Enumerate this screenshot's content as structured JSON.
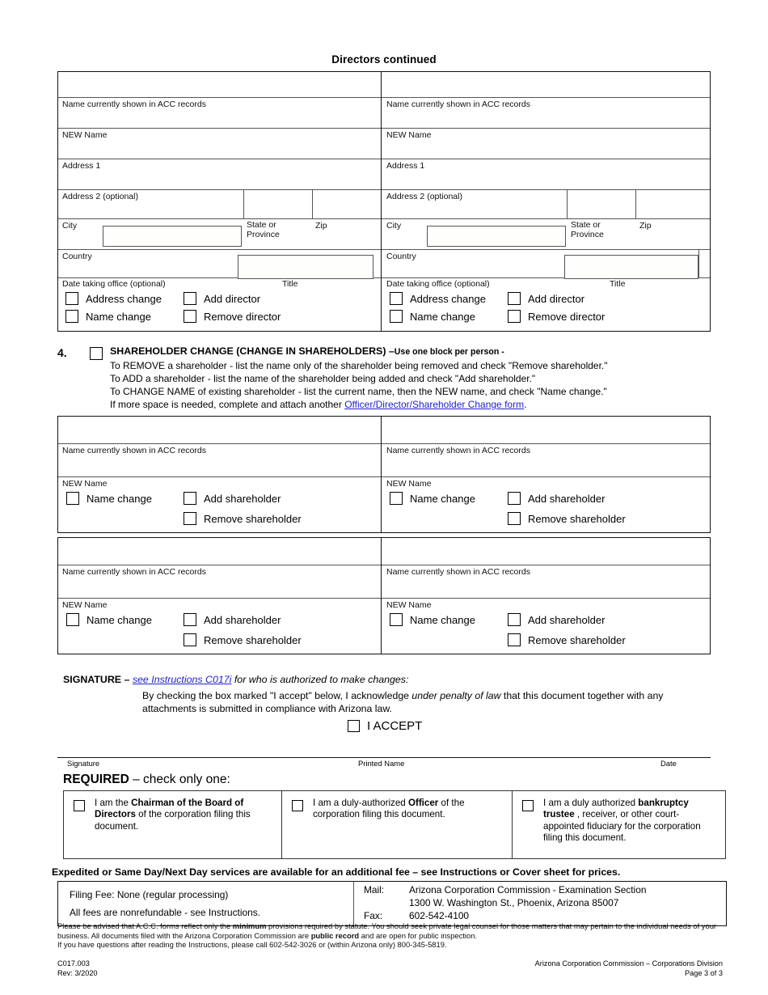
{
  "page": {
    "title": "Directors continued"
  },
  "directors_table": {
    "labels": {
      "name_current": "Name currently shown in ACC records",
      "new_name": "NEW Name",
      "address1": "Address 1",
      "address2": "Address 2 (optional)",
      "city": "City",
      "state_province": "State or Province",
      "zip": "Zip",
      "country": "Country",
      "date_taking_office": "Date taking office (optional)",
      "title": "Title"
    },
    "checkboxes": {
      "address_change": "Address change",
      "add_director": "Add director",
      "name_change": "Name change",
      "remove_director": "Remove director"
    }
  },
  "section4": {
    "number": "4.",
    "heading": "SHAREHOLDER CHANGE (CHANGE IN SHAREHOLDERS) –",
    "heading_sub": "Use one block per person -",
    "line1": "To REMOVE a shareholder - list the name only of the shareholder being removed and check \"Remove shareholder.\"",
    "line2": "To ADD  a shareholder - list the name of the shareholder being added and check \"Add shareholder.\"",
    "line3": "To CHANGE NAME of existing shareholder - list the current name, then the NEW name, and check \"Name change.\"",
    "line4_pre": "If more space is needed, complete and attach another ",
    "line4_link": "Officer/Director/Shareholder Change form",
    "line4_post": "."
  },
  "shareholder_table": {
    "labels": {
      "name_current": "Name currently shown in ACC records",
      "new_name": "NEW Name"
    },
    "checkboxes": {
      "name_change": "Name change",
      "add_shareholder": "Add shareholder",
      "remove_shareholder": "Remove shareholder"
    }
  },
  "signature": {
    "heading": "SIGNATURE – ",
    "link": "see Instructions C017i",
    "heading_rest": " for who is authorized to make changes:",
    "body_pre": "By checking the box marked \"I accept\" below, I acknowledge ",
    "body_em": "under penalty of law",
    "body_post": " that this document together with any attachments is submitted in compliance with Arizona law.",
    "accept_label": "I ACCEPT",
    "caption_signature": "Signature",
    "caption_printed_name": "Printed Name",
    "caption_date": "Date"
  },
  "required": {
    "title_bold": "REQUIRED",
    "title_rest": " – check only one:",
    "options": [
      {
        "pre": "I am the ",
        "bold": "Chairman of the Board of Directors",
        "post": " of the corporation filing this document."
      },
      {
        "pre": "I am a duly-authorized ",
        "bold": "Officer",
        "post": " of the corporation filing this document."
      },
      {
        "pre": "I am a duly authorized ",
        "bold": "bankruptcy trustee",
        "post": " , receiver, or other court-appointed fiduciary for the corporation filing this document."
      }
    ]
  },
  "footer": {
    "expedited": "Expedited or Same Day/Next Day services are available for an additional fee – see Instructions or Cover sheet for prices.",
    "filing_fee_line1": "Filing Fee:  None (regular processing)",
    "filing_fee_line2": "All fees are nonrefundable - see Instructions.",
    "mail_label": "Mail:",
    "mail_line1": "Arizona Corporation Commission - Examination Section",
    "mail_line2": "1300 W. Washington St., Phoenix, Arizona  85007",
    "fax_label": "Fax:",
    "fax_number": "602-542-4100",
    "fine_pre1": "Please be advised that A.C.C. forms reflect only the ",
    "fine_bold1": "minimum",
    "fine_post1": " provisions required by statute.  You should seek private legal counsel for those matters that may pertain to the individual needs of your business. All documents filed with the Arizona Corporation Commission are ",
    "fine_bold2": "public record",
    "fine_post2": " and are open for public inspection.",
    "fine_line3": "If you have questions after reading the Instructions, please call 602-542-3026 or (within Arizona only) 800-345-5819.",
    "doc_id": "C017.003",
    "doc_rev": "Rev: 3/2020",
    "agency": "Arizona Corporation Commission – Corporations Division",
    "page_number": "Page 3 of 3"
  }
}
